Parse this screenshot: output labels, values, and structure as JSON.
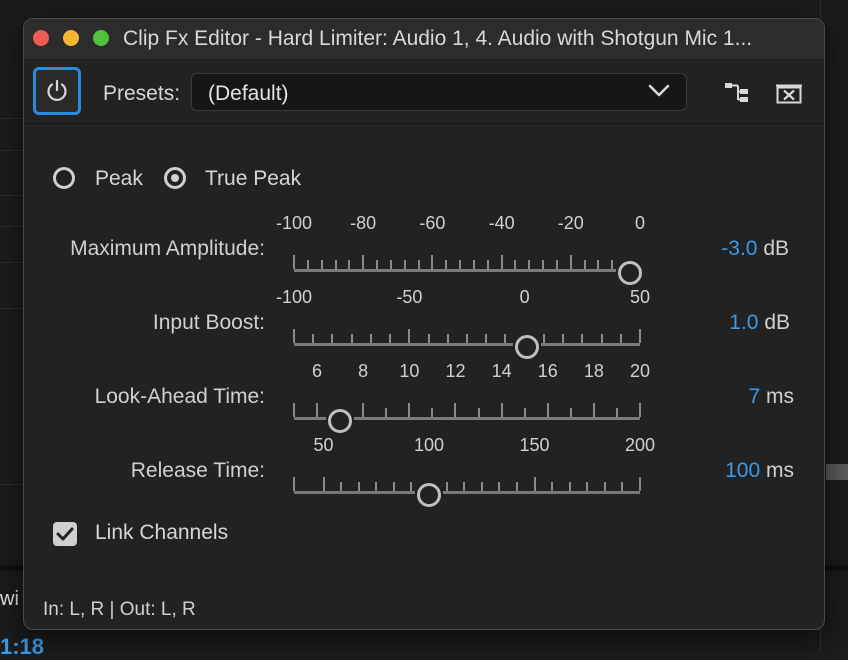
{
  "background": {
    "partial_text": "wi",
    "timecode_partial": "1:18"
  },
  "window": {
    "title": "Clip Fx Editor - Hard Limiter: Audio 1, 4. Audio with Shotgun Mic 1...",
    "presets_label": "Presets:",
    "preset_value": "(Default)",
    "accent_color": "#2a8ae0"
  },
  "peak_mode": {
    "options": [
      {
        "label": "Peak",
        "selected": false
      },
      {
        "label": "True Peak",
        "selected": true
      }
    ]
  },
  "params": [
    {
      "label": "Maximum Amplitude:",
      "ticks": [
        "-100",
        "-80",
        "-60",
        "-40",
        "-20",
        "0"
      ],
      "min": -100,
      "max": 0,
      "value": -3.0,
      "value_text": "-3.0",
      "unit": "dB"
    },
    {
      "label": "Input Boost:",
      "ticks": [
        "-100",
        "-50",
        "0",
        "50"
      ],
      "min": -100,
      "max": 50,
      "value": 1.0,
      "value_text": "1.0",
      "unit": "dB"
    },
    {
      "label": "Look-Ahead Time:",
      "ticks": [
        "6",
        "8",
        "10",
        "12",
        "14",
        "16",
        "18",
        "20"
      ],
      "min": 5,
      "max": 20,
      "value": 7,
      "value_text": "7",
      "unit": "ms"
    },
    {
      "label": "Release Time:",
      "ticks": [
        "50",
        "100",
        "150",
        "200"
      ],
      "min": 36,
      "max": 200,
      "value": 100,
      "value_text": "100",
      "unit": "ms"
    }
  ],
  "link_channels": {
    "label": "Link Channels",
    "checked": true
  },
  "io": "In: L, R | Out: L, R"
}
